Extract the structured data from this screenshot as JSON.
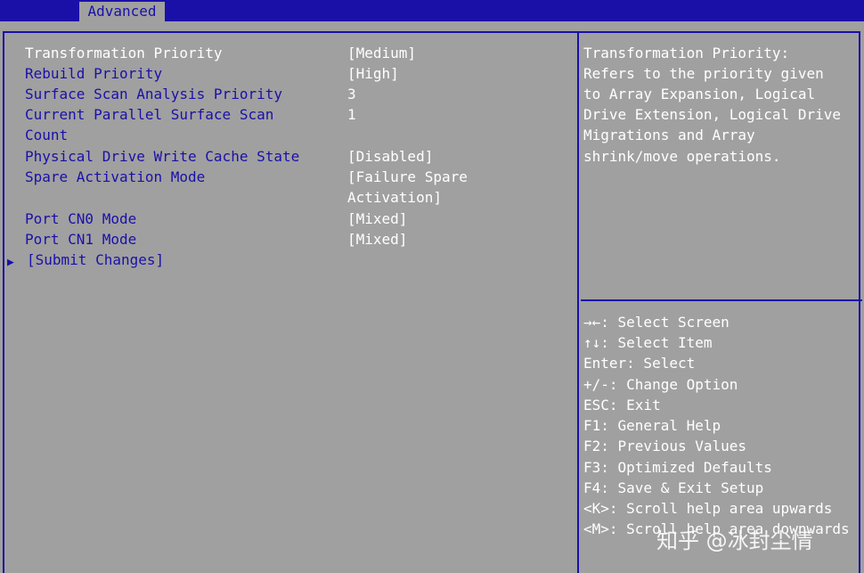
{
  "header": {
    "active_tab": "Advanced"
  },
  "settings": [
    {
      "label": "Transformation Priority",
      "value": "[Medium]",
      "selected": true
    },
    {
      "label": "Rebuild Priority",
      "value": "[High]"
    },
    {
      "label": "Surface Scan Analysis Priority",
      "value": "3"
    },
    {
      "label": "Current Parallel Surface Scan",
      "label2": "Count",
      "value": "1"
    },
    {
      "label": "Physical Drive Write Cache State",
      "value": "[Disabled]"
    },
    {
      "label": "Spare Activation Mode",
      "value": "[Failure Spare",
      "value2": "Activation]"
    },
    {
      "label": "Port CN0 Mode",
      "value": "[Mixed]"
    },
    {
      "label": "Port CN1 Mode",
      "value": "[Mixed]"
    }
  ],
  "submit": {
    "arrow": "▶",
    "label": "[Submit Changes]"
  },
  "help": {
    "lines": [
      "Transformation Priority:",
      "Refers to the priority given",
      "to Array Expansion, Logical",
      "Drive Extension, Logical Drive",
      "Migrations and Array",
      "shrink/move operations."
    ]
  },
  "keys": [
    {
      "key": "→←",
      "text": ": Select Screen"
    },
    {
      "key": "↑↓",
      "text": ": Select Item"
    },
    {
      "key": "",
      "text": "Enter: Select"
    },
    {
      "key": "",
      "text": "+/-: Change Option"
    },
    {
      "key": "",
      "text": "ESC: Exit"
    },
    {
      "key": "",
      "text": "F1: General Help"
    },
    {
      "key": "",
      "text": "F2: Previous Values"
    },
    {
      "key": "",
      "text": "F3: Optimized Defaults"
    },
    {
      "key": "",
      "text": "F4: Save & Exit Setup"
    },
    {
      "key": "",
      "text": "<K>: Scroll help area upwards"
    },
    {
      "key": "",
      "text": "<M>: Scroll help area downwards"
    }
  ],
  "watermark": "知乎 @冰封尘情",
  "colors": {
    "background": "#a0a0a0",
    "accent": "#1a10a8",
    "text_white": "#ffffff"
  }
}
